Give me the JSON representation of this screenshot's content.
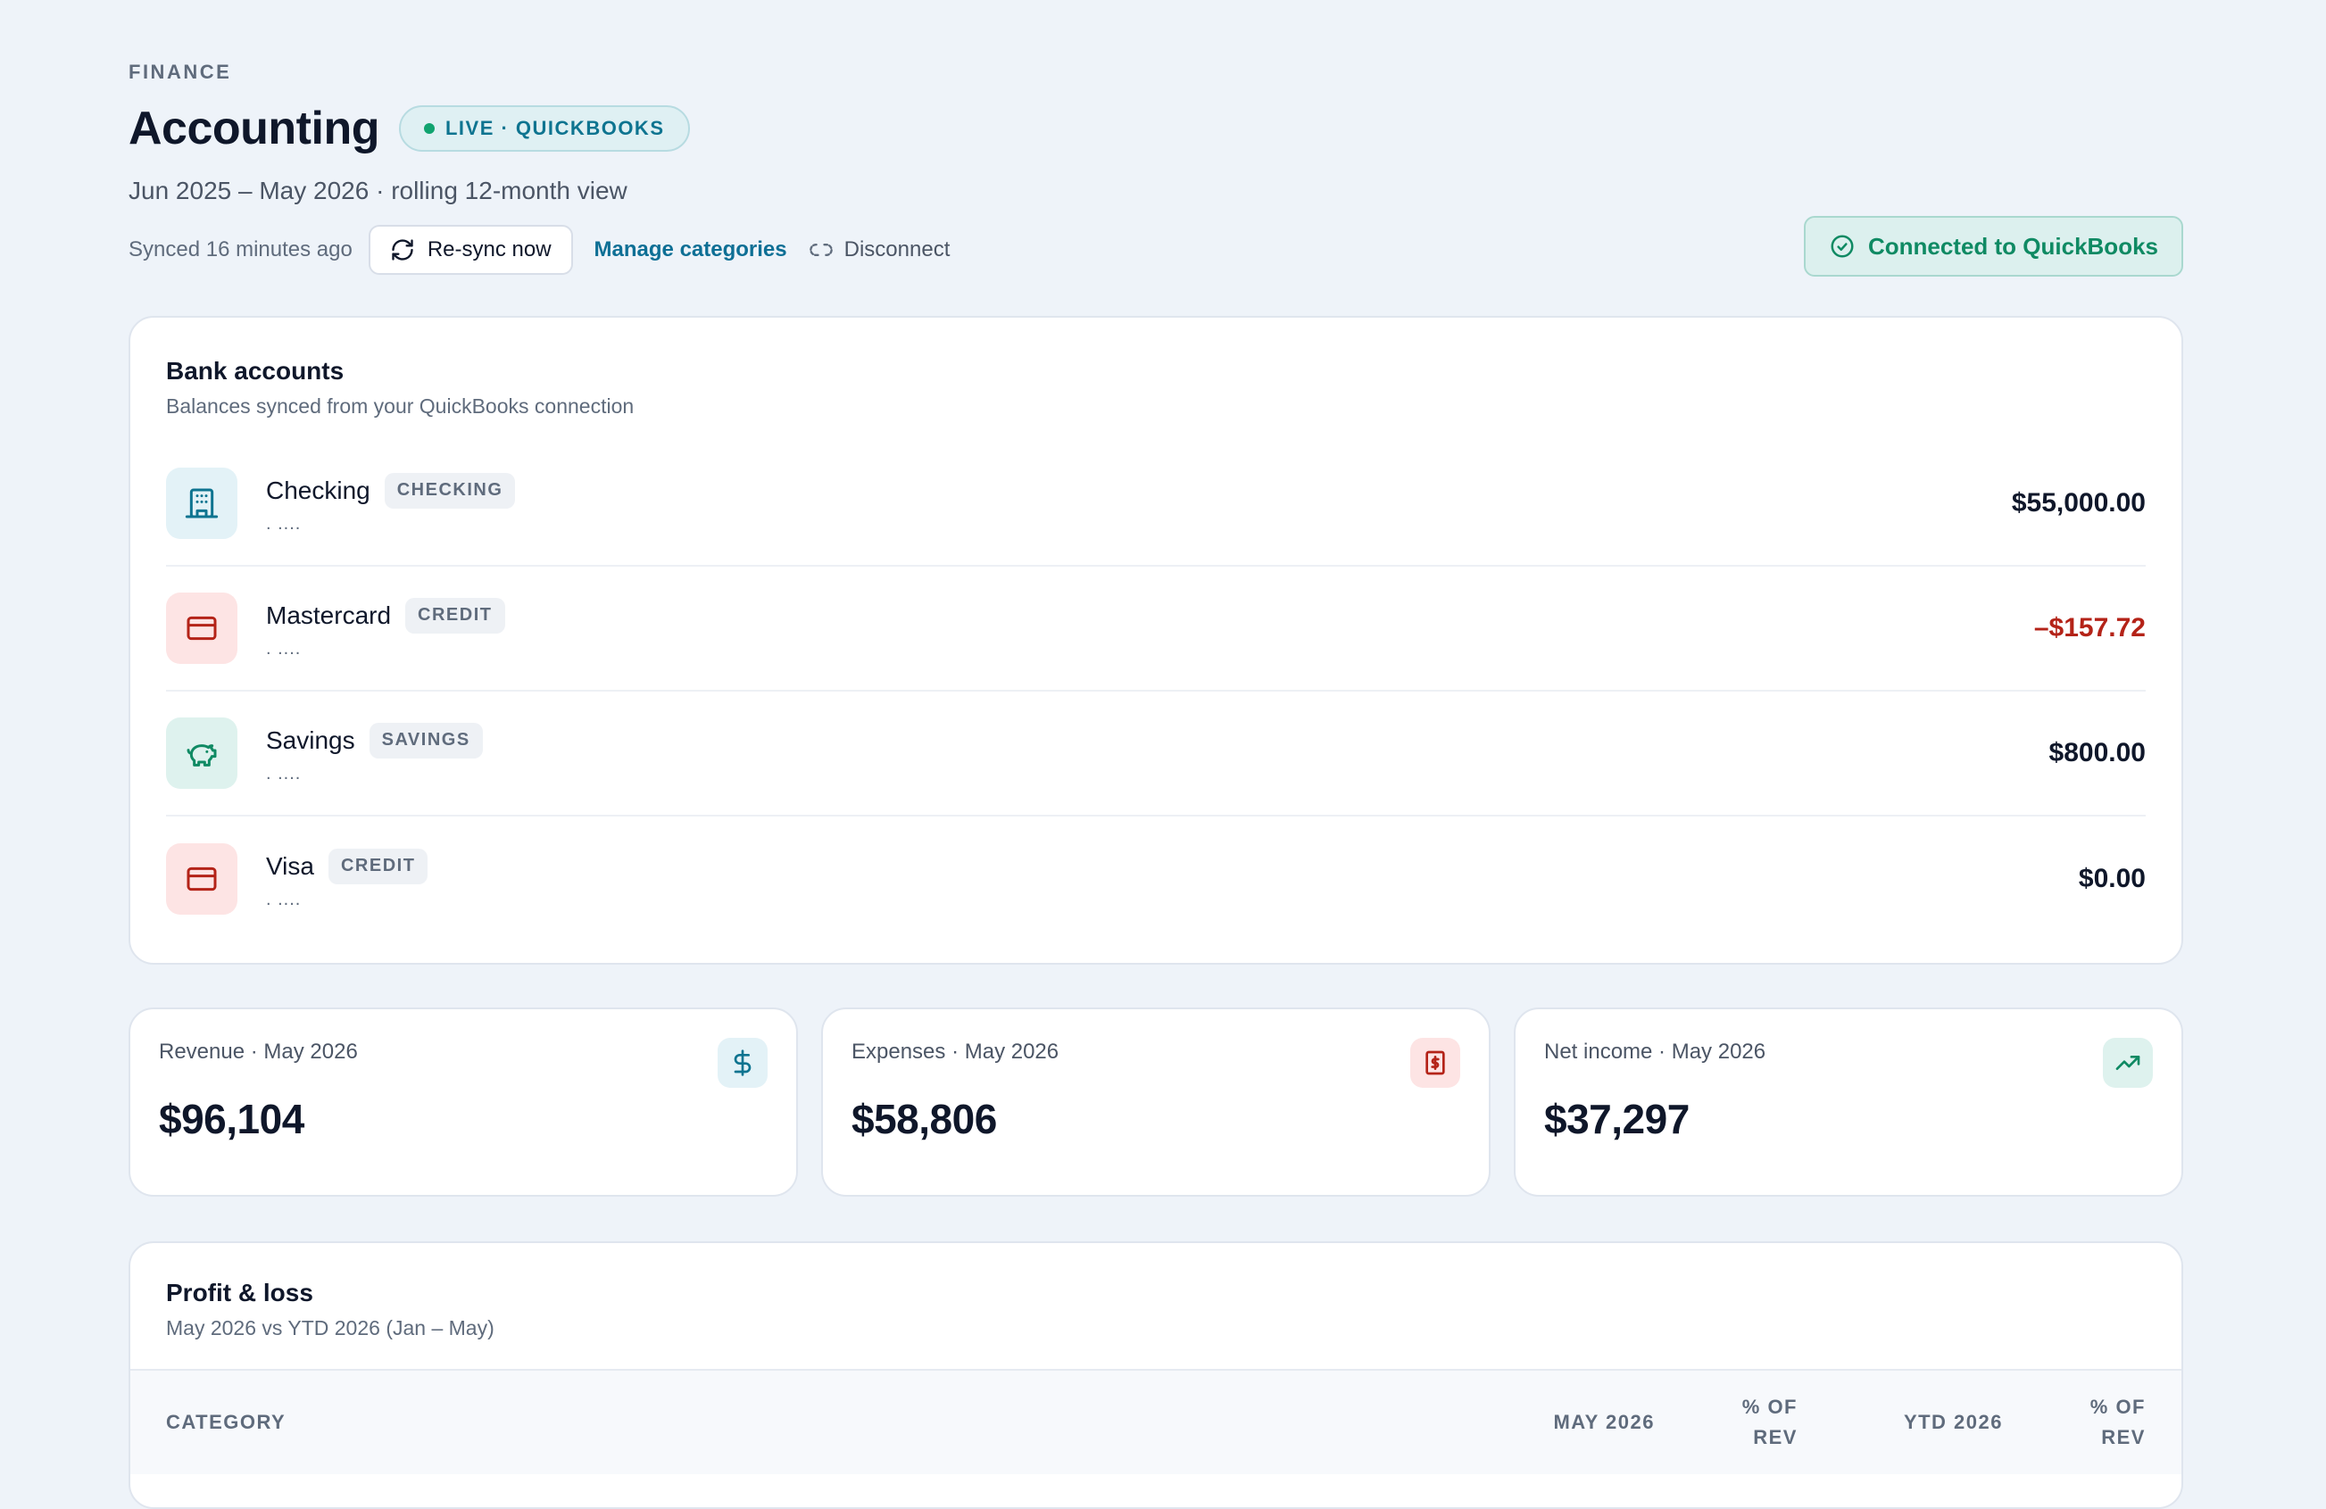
{
  "header": {
    "eyebrow": "FINANCE",
    "title": "Accounting",
    "live_pill": "LIVE · QUICKBOOKS",
    "subtitle": "Jun 2025 – May 2026 · rolling 12-month view",
    "synced": "Synced 16 minutes ago",
    "resync_label": "Re-sync now",
    "manage_label": "Manage categories",
    "disconnect_label": "Disconnect",
    "connected_label": "Connected to QuickBooks"
  },
  "bank": {
    "title": "Bank accounts",
    "subtitle": "Balances synced from your QuickBooks connection",
    "accounts": [
      {
        "name": "Checking",
        "type": "CHECKING",
        "mask": ". ....",
        "balance": "$55,000.00",
        "icon": "building-icon"
      },
      {
        "name": "Mastercard",
        "type": "CREDIT",
        "mask": ". ....",
        "balance": "–$157.72",
        "icon": "credit-card-icon"
      },
      {
        "name": "Savings",
        "type": "SAVINGS",
        "mask": ". ....",
        "balance": "$800.00",
        "icon": "piggy-bank-icon"
      },
      {
        "name": "Visa",
        "type": "CREDIT",
        "mask": ". ....",
        "balance": "$0.00",
        "icon": "credit-card-icon"
      }
    ]
  },
  "kpis": [
    {
      "label": "Revenue · May 2026",
      "value": "$96,104",
      "icon": "dollar-icon"
    },
    {
      "label": "Expenses · May 2026",
      "value": "$58,806",
      "icon": "receipt-icon"
    },
    {
      "label": "Net income · May 2026",
      "value": "$37,297",
      "icon": "trending-up-icon"
    }
  ],
  "pl": {
    "title": "Profit & loss",
    "subtitle": "May 2026 vs YTD 2026 (Jan – May)",
    "columns": {
      "category": "CATEGORY",
      "may": "MAY 2026",
      "pct1_a": "% OF",
      "pct1_b": "REV",
      "ytd": "YTD 2026",
      "pct2_a": "% OF",
      "pct2_b": "REV"
    }
  },
  "colors": {
    "background": "#eef3f9",
    "accent": "#0e7490",
    "positive": "#0f8a63",
    "negative": "#b42318"
  }
}
